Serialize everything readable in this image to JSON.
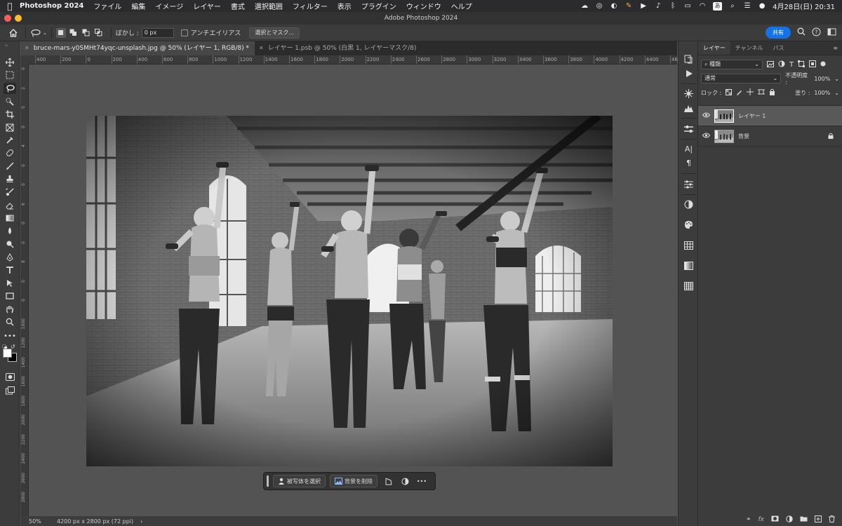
{
  "menubar": {
    "app_name": "Photoshop 2024",
    "items": [
      "ファイル",
      "編集",
      "イメージ",
      "レイヤー",
      "書式",
      "選択範囲",
      "フィルター",
      "表示",
      "プラグイン",
      "ウィンドウ",
      "ヘルプ"
    ],
    "input_mode": "あ",
    "clock": "4月28日(日)  20:31"
  },
  "window": {
    "title": "Adobe Photoshop 2024"
  },
  "options_bar": {
    "feather_label": "ぼかし :",
    "feather_value": "0 px",
    "antialias_label": "アンチエイリアス",
    "select_mask_label": "選択とマスク...",
    "share_label": "共有"
  },
  "doc_tabs": [
    {
      "label": "bruce-mars-y0SMHt74yqc-unsplash.jpg @ 50% (レイヤー 1, RGB/8) *",
      "active": true
    },
    {
      "label": "レイヤー 1.psb @ 50% (白黒 1, レイヤーマスク/8)",
      "active": false
    }
  ],
  "ruler": {
    "h_ticks": [
      "400",
      "200",
      "0",
      "200",
      "400",
      "600",
      "800",
      "1000",
      "1200",
      "1400",
      "1600",
      "1800",
      "2000",
      "2200",
      "2400",
      "2600",
      "2800",
      "3000",
      "3200",
      "3400",
      "3600",
      "3800",
      "4000",
      "4200",
      "4400",
      "46"
    ],
    "v_ticks": [
      "0",
      "2",
      "0",
      "0",
      "4",
      "0",
      "0",
      "6",
      "0",
      "0",
      "8",
      "0",
      "0",
      "1000",
      "1200",
      "1400",
      "1600",
      "1800",
      "2000",
      "2200",
      "2400",
      "2600",
      "2800"
    ]
  },
  "context_bar": {
    "select_subject": "被写体を選択",
    "remove_bg": "背景を削除",
    "more": "•••"
  },
  "status": {
    "zoom": "50%",
    "dimensions": "4200 px x 2800 px (72 ppi)",
    "arrow": "›"
  },
  "layers_panel": {
    "tabs": [
      "レイヤー",
      "チャンネル",
      "パス"
    ],
    "filter_kind": "種類",
    "blend_mode": "通常",
    "opacity_label": "不透明度 :",
    "opacity_value": "100%",
    "lock_label": "ロック :",
    "fill_label": "塗り :",
    "fill_value": "100%",
    "layers": [
      {
        "name": "レイヤー 1",
        "active": true,
        "locked": false
      },
      {
        "name": "背景",
        "active": false,
        "locked": true
      }
    ]
  }
}
